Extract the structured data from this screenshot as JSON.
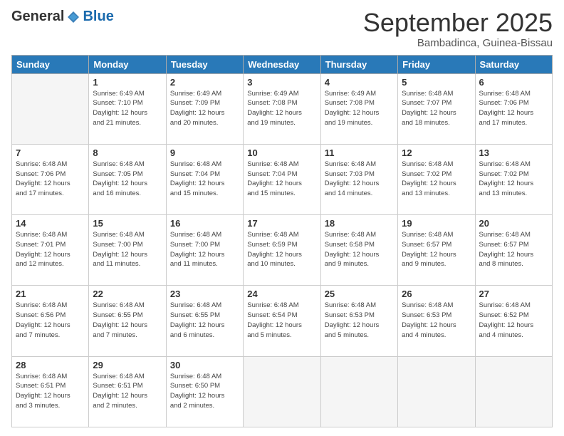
{
  "header": {
    "logo_general": "General",
    "logo_blue": "Blue",
    "month_title": "September 2025",
    "location": "Bambadinca, Guinea-Bissau"
  },
  "weekdays": [
    "Sunday",
    "Monday",
    "Tuesday",
    "Wednesday",
    "Thursday",
    "Friday",
    "Saturday"
  ],
  "weeks": [
    [
      {
        "day": "",
        "info": ""
      },
      {
        "day": "1",
        "info": "Sunrise: 6:49 AM\nSunset: 7:10 PM\nDaylight: 12 hours\nand 21 minutes."
      },
      {
        "day": "2",
        "info": "Sunrise: 6:49 AM\nSunset: 7:09 PM\nDaylight: 12 hours\nand 20 minutes."
      },
      {
        "day": "3",
        "info": "Sunrise: 6:49 AM\nSunset: 7:08 PM\nDaylight: 12 hours\nand 19 minutes."
      },
      {
        "day": "4",
        "info": "Sunrise: 6:49 AM\nSunset: 7:08 PM\nDaylight: 12 hours\nand 19 minutes."
      },
      {
        "day": "5",
        "info": "Sunrise: 6:48 AM\nSunset: 7:07 PM\nDaylight: 12 hours\nand 18 minutes."
      },
      {
        "day": "6",
        "info": "Sunrise: 6:48 AM\nSunset: 7:06 PM\nDaylight: 12 hours\nand 17 minutes."
      }
    ],
    [
      {
        "day": "7",
        "info": "Sunrise: 6:48 AM\nSunset: 7:06 PM\nDaylight: 12 hours\nand 17 minutes."
      },
      {
        "day": "8",
        "info": "Sunrise: 6:48 AM\nSunset: 7:05 PM\nDaylight: 12 hours\nand 16 minutes."
      },
      {
        "day": "9",
        "info": "Sunrise: 6:48 AM\nSunset: 7:04 PM\nDaylight: 12 hours\nand 15 minutes."
      },
      {
        "day": "10",
        "info": "Sunrise: 6:48 AM\nSunset: 7:04 PM\nDaylight: 12 hours\nand 15 minutes."
      },
      {
        "day": "11",
        "info": "Sunrise: 6:48 AM\nSunset: 7:03 PM\nDaylight: 12 hours\nand 14 minutes."
      },
      {
        "day": "12",
        "info": "Sunrise: 6:48 AM\nSunset: 7:02 PM\nDaylight: 12 hours\nand 13 minutes."
      },
      {
        "day": "13",
        "info": "Sunrise: 6:48 AM\nSunset: 7:02 PM\nDaylight: 12 hours\nand 13 minutes."
      }
    ],
    [
      {
        "day": "14",
        "info": "Sunrise: 6:48 AM\nSunset: 7:01 PM\nDaylight: 12 hours\nand 12 minutes."
      },
      {
        "day": "15",
        "info": "Sunrise: 6:48 AM\nSunset: 7:00 PM\nDaylight: 12 hours\nand 11 minutes."
      },
      {
        "day": "16",
        "info": "Sunrise: 6:48 AM\nSunset: 7:00 PM\nDaylight: 12 hours\nand 11 minutes."
      },
      {
        "day": "17",
        "info": "Sunrise: 6:48 AM\nSunset: 6:59 PM\nDaylight: 12 hours\nand 10 minutes."
      },
      {
        "day": "18",
        "info": "Sunrise: 6:48 AM\nSunset: 6:58 PM\nDaylight: 12 hours\nand 9 minutes."
      },
      {
        "day": "19",
        "info": "Sunrise: 6:48 AM\nSunset: 6:57 PM\nDaylight: 12 hours\nand 9 minutes."
      },
      {
        "day": "20",
        "info": "Sunrise: 6:48 AM\nSunset: 6:57 PM\nDaylight: 12 hours\nand 8 minutes."
      }
    ],
    [
      {
        "day": "21",
        "info": "Sunrise: 6:48 AM\nSunset: 6:56 PM\nDaylight: 12 hours\nand 7 minutes."
      },
      {
        "day": "22",
        "info": "Sunrise: 6:48 AM\nSunset: 6:55 PM\nDaylight: 12 hours\nand 7 minutes."
      },
      {
        "day": "23",
        "info": "Sunrise: 6:48 AM\nSunset: 6:55 PM\nDaylight: 12 hours\nand 6 minutes."
      },
      {
        "day": "24",
        "info": "Sunrise: 6:48 AM\nSunset: 6:54 PM\nDaylight: 12 hours\nand 5 minutes."
      },
      {
        "day": "25",
        "info": "Sunrise: 6:48 AM\nSunset: 6:53 PM\nDaylight: 12 hours\nand 5 minutes."
      },
      {
        "day": "26",
        "info": "Sunrise: 6:48 AM\nSunset: 6:53 PM\nDaylight: 12 hours\nand 4 minutes."
      },
      {
        "day": "27",
        "info": "Sunrise: 6:48 AM\nSunset: 6:52 PM\nDaylight: 12 hours\nand 4 minutes."
      }
    ],
    [
      {
        "day": "28",
        "info": "Sunrise: 6:48 AM\nSunset: 6:51 PM\nDaylight: 12 hours\nand 3 minutes."
      },
      {
        "day": "29",
        "info": "Sunrise: 6:48 AM\nSunset: 6:51 PM\nDaylight: 12 hours\nand 2 minutes."
      },
      {
        "day": "30",
        "info": "Sunrise: 6:48 AM\nSunset: 6:50 PM\nDaylight: 12 hours\nand 2 minutes."
      },
      {
        "day": "",
        "info": ""
      },
      {
        "day": "",
        "info": ""
      },
      {
        "day": "",
        "info": ""
      },
      {
        "day": "",
        "info": ""
      }
    ]
  ]
}
